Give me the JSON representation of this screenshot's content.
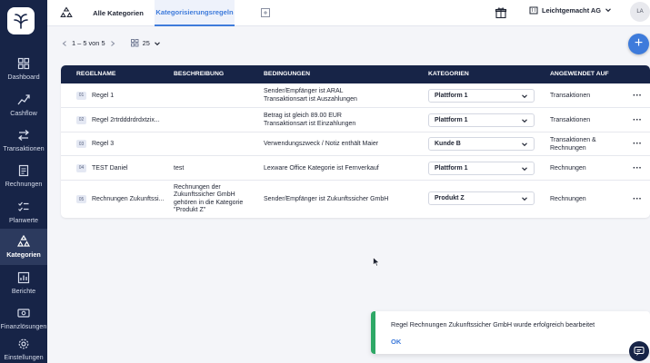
{
  "sidebar": {
    "items": [
      {
        "label": "Dashboard",
        "icon": "dashboard-icon"
      },
      {
        "label": "Cashflow",
        "icon": "cashflow-icon"
      },
      {
        "label": "Transaktionen",
        "icon": "transactions-icon"
      },
      {
        "label": "Rechnungen",
        "icon": "invoice-icon"
      },
      {
        "label": "Planwerte",
        "icon": "plan-icon"
      },
      {
        "label": "Kategorien",
        "icon": "categories-icon"
      },
      {
        "label": "Berichte",
        "icon": "reports-icon"
      },
      {
        "label": "Finanzlösungen",
        "icon": "finance-icon"
      },
      {
        "label": "Einstellungen",
        "icon": "settings-icon"
      }
    ],
    "active": "Kategorien"
  },
  "topbar": {
    "tabs": [
      {
        "label": "Alle Kategorien"
      },
      {
        "label": "Kategorisierungsregeln"
      }
    ],
    "company": "Leichtgemacht AG",
    "avatar_initials": "LA"
  },
  "pager": {
    "range": "1 – 5 von 5",
    "page_size": "25"
  },
  "table": {
    "headers": {
      "name": "REGELNAME",
      "description": "BESCHREIBUNG",
      "conditions": "BEDINGUNGEN",
      "categories": "KATEGORIEN",
      "applied": "ANGEWENDET AUF"
    },
    "rows": [
      {
        "num": "01",
        "name": "Regel 1",
        "description": "",
        "cond1": "Sender/Empfänger ist ARAL",
        "cond2": "Transaktionsart ist Auszahlungen",
        "category": "Plattform 1",
        "applied1": "Transaktionen",
        "applied2": ""
      },
      {
        "num": "02",
        "name": "Regel 2rtrdddrdrdxtzix...",
        "description": "",
        "cond1": "Betrag ist gleich 89.00 EUR",
        "cond2": "Transaktionsart ist Einzahlungen",
        "category": "Plattform 1",
        "applied1": "Transaktionen",
        "applied2": ""
      },
      {
        "num": "03",
        "name": "Regel 3",
        "description": "",
        "cond1": "Verwendungszweck / Notiz enthält Maier",
        "cond2": "",
        "category": "Kunde B",
        "applied1": "Transaktionen &",
        "applied2": "Rechnungen"
      },
      {
        "num": "04",
        "name": "TEST Daniel",
        "description": "test",
        "cond1": "Lexware Office Kategorie ist Fernverkauf",
        "cond2": "",
        "category": "Plattform 1",
        "applied1": "Rechnungen",
        "applied2": ""
      },
      {
        "num": "05",
        "name": "Rechnungen Zukunftssi...",
        "description": "Rechnungen der Zukunftssicher GmbH gehören in die Kategorie \"Produkt Z\"",
        "cond1": "Sender/Empfänger ist Zukunftssicher GmbH",
        "cond2": "",
        "category": "Produkt Z",
        "applied1": "Rechnungen",
        "applied2": ""
      }
    ]
  },
  "toast": {
    "message": "Regel Rechnungen Zukunftssicher GmbH wurde erfolgreich bearbeitet",
    "ok_label": "OK"
  },
  "colors": {
    "sidebar": "#172447",
    "accent": "#3e7bdb",
    "success": "#2ea866"
  }
}
